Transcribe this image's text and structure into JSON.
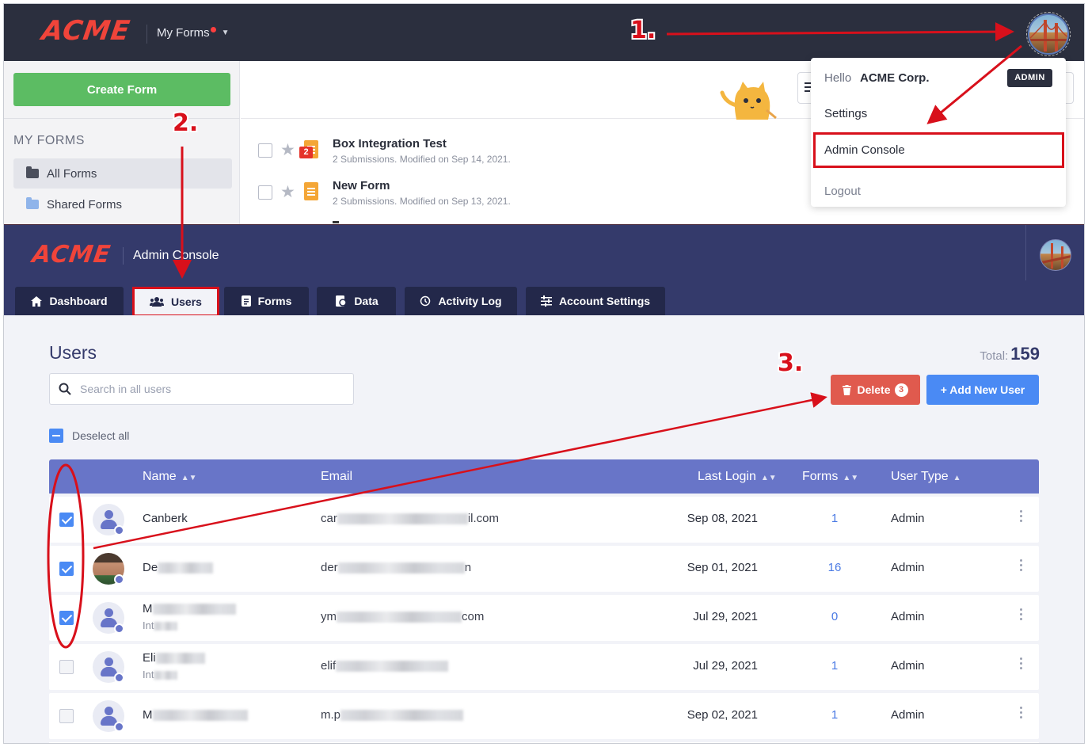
{
  "top": {
    "logo": "ACME",
    "nav_label": "My Forms",
    "create_form_label": "Create Form",
    "my_forms_heading": "MY FORMS",
    "folders": [
      {
        "label": "All Forms"
      },
      {
        "label": "Shared Forms"
      }
    ],
    "forms": [
      {
        "title": "Box Integration Test",
        "subtitle": "2 Submissions. Modified on Sep 14, 2021.",
        "badge": "2"
      },
      {
        "title": "New Form",
        "subtitle": "2 Submissions. Modified on Sep 13, 2021."
      }
    ]
  },
  "dropdown": {
    "hello": "Hello",
    "company": "ACME Corp.",
    "role_badge": "ADMIN",
    "settings": "Settings",
    "admin_console": "Admin Console",
    "logout": "Logout"
  },
  "admin": {
    "logo": "ACME",
    "title": "Admin Console",
    "tabs": [
      {
        "label": "Dashboard",
        "icon": "home-icon"
      },
      {
        "label": "Users",
        "icon": "users-icon",
        "active": true
      },
      {
        "label": "Forms",
        "icon": "forms-icon"
      },
      {
        "label": "Data",
        "icon": "data-icon"
      },
      {
        "label": "Activity Log",
        "icon": "history-icon"
      },
      {
        "label": "Account Settings",
        "icon": "sliders-icon"
      }
    ]
  },
  "users": {
    "title": "Users",
    "total_label": "Total:",
    "total_count": "159",
    "search_placeholder": "Search in all users",
    "delete_label": "Delete",
    "delete_count": "3",
    "add_user_label": "+ Add New User",
    "deselect_label": "Deselect all",
    "columns": {
      "name": "Name",
      "email": "Email",
      "last_login": "Last Login",
      "forms": "Forms",
      "user_type": "User Type"
    },
    "rows": [
      {
        "name": "Canberk",
        "email_start": "car",
        "email_end": "il.com",
        "last_login": "Sep 08, 2021",
        "forms": "1",
        "user_type": "Admin",
        "checked": true
      },
      {
        "name": "De",
        "email_start": "der",
        "email_end": "n",
        "last_login": "Sep 01, 2021",
        "forms": "16",
        "user_type": "Admin",
        "checked": true
      },
      {
        "name": "M",
        "sub": "Int",
        "email_start": "ym",
        "email_end": "com",
        "last_login": "Jul 29, 2021",
        "forms": "0",
        "user_type": "Admin",
        "checked": true
      },
      {
        "name": "Eli",
        "sub": "Int",
        "email_start": "elif",
        "email_end": "",
        "last_login": "Jul 29, 2021",
        "forms": "1",
        "user_type": "Admin",
        "checked": false
      },
      {
        "name": "M",
        "email_start": "m.p",
        "email_end": "",
        "last_login": "Sep 02, 2021",
        "forms": "1",
        "user_type": "Admin",
        "checked": false
      }
    ]
  },
  "annotations": {
    "step1": "1.",
    "step2": "2.",
    "step3": "3."
  },
  "colors": {
    "brand_red": "#f0443a",
    "annotation_red": "#d8101b",
    "header_dark": "#2b2f3e",
    "admin_navy": "#343a6b",
    "table_header": "#6875c8",
    "primary_blue": "#4a8af4",
    "delete_red": "#e05a4e",
    "create_green": "#5cbc63"
  }
}
